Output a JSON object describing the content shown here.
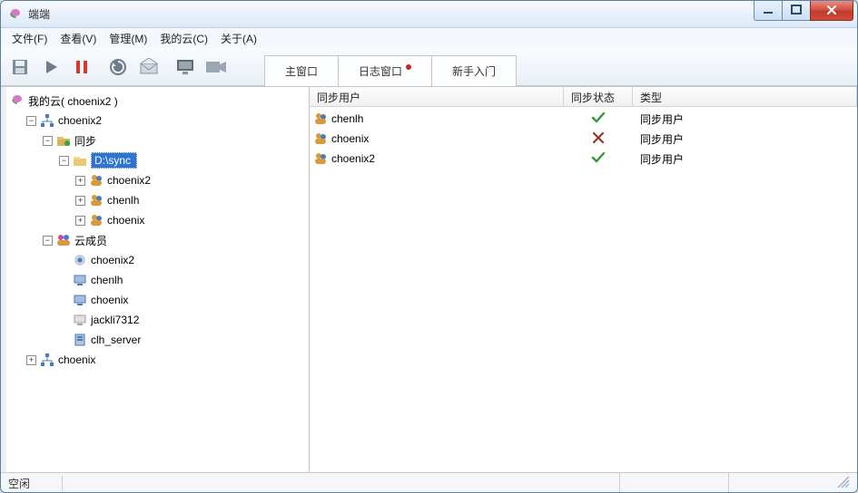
{
  "window": {
    "title": "端端"
  },
  "menubar": {
    "file": "文件(F)",
    "view": "查看(V)",
    "manage": "管理(M)",
    "mycloud": "我的云(C)",
    "about": "关于(A)"
  },
  "tabs": {
    "main": "主窗口",
    "log": "日志窗口",
    "beginner": "新手入门"
  },
  "tree": {
    "root_label": "我的云( choenix2 )",
    "cloud1": {
      "label": "choenix2",
      "sync_label": "同步",
      "sync_path": "D:\\sync",
      "sync_children": [
        "choenix2",
        "chenlh",
        "choenix"
      ],
      "members_label": "云成员",
      "members": [
        "choenix2",
        "chenlh",
        "choenix",
        "jackli7312",
        "clh_server"
      ]
    },
    "cloud2_label": "choenix"
  },
  "list": {
    "col_user": "同步用户",
    "col_status": "同步状态",
    "col_type": "类型",
    "rows": [
      {
        "user": "chenlh",
        "status": "ok",
        "type": "同步用户"
      },
      {
        "user": "choenix",
        "status": "fail",
        "type": "同步用户"
      },
      {
        "user": "choenix2",
        "status": "ok",
        "type": "同步用户"
      }
    ]
  },
  "statusbar": {
    "text": "空闲"
  }
}
